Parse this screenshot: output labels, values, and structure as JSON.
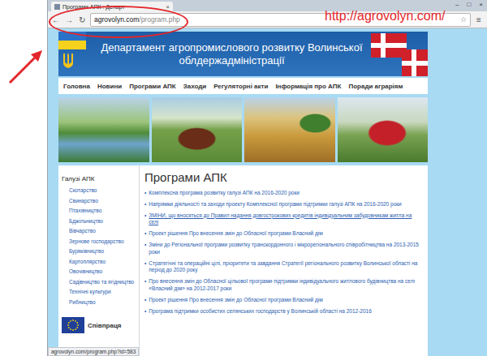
{
  "browser": {
    "tab_title": "Програми АПК : Департ",
    "tab_close": "×",
    "window_controls": [
      "–",
      "□",
      "×"
    ],
    "nav_buttons": [
      "←",
      "→",
      "↻"
    ],
    "url_host": "agrovolyn.com",
    "url_path": "/program.php",
    "star": "☆",
    "menu": "≡",
    "status": "agrovolyn.com/program.php?id=583"
  },
  "annotation": {
    "label": "http://agrovolyn.com/"
  },
  "site": {
    "title_lines": [
      "Департамент агропромислового розвитку Волинської",
      "облдержадміністрації"
    ],
    "nav": [
      "Головна",
      "Новини",
      "Програми АПК",
      "Заходи",
      "Регуляторні акти",
      "Інформація про АПК",
      "Поради аграріям"
    ],
    "photos": [
      {
        "kind": "river"
      },
      {
        "kind": "cattle"
      },
      {
        "kind": "harvest"
      },
      {
        "kind": "tractor"
      }
    ]
  },
  "sidebar": {
    "heading": "Галузі АПК",
    "items": [
      "Скотарство",
      "Свинарство",
      "Птахівництво",
      "Бджільництво",
      "Вівчарство",
      "Зернове господарство",
      "Буряківництво",
      "Картоплярство",
      "Овочівництво",
      "Садівництво та ягідництво",
      "Технічні культури",
      "Рибництво"
    ],
    "partner": "Співпраця"
  },
  "content": {
    "heading": "Програми АПК",
    "bullet": "•",
    "items": [
      {
        "text": "Комплексна програма розвитку галузі АПК на 2016-2020 роки",
        "underlined": false
      },
      {
        "text": "Напрямки діяльності та заходи проекту Комплексної програми підтримки галузі АПК на 2016-2020 роки",
        "underlined": false
      },
      {
        "text": "ЗМІНИ, що вносяться до Правил надання довгострокових кредитів індивідуальним забудовникам житла на селі",
        "underlined": true
      },
      {
        "text": "Проект рішення Про внесення змін до Обласної програми Власний дім",
        "underlined": false
      },
      {
        "text": "Зміни до Регіональної програми розвитку транскордонного і мікрорегіонального співробітництва на 2013-2015 роки",
        "underlined": false
      },
      {
        "text": "Стратегічні та операційні цілі, пріоритети та завдання Стратегії регіонального розвитку Волинської області на період до 2020 року",
        "underlined": false
      },
      {
        "text": "Про внесення змін до Обласної цільової програми підтримки індивідуального житлового будівництва на селі «Власний дім» на 2012-2017 роки",
        "underlined": false
      },
      {
        "text": "Проект рішення Про внесення змін до Обласної програми Власний дім",
        "underlined": false
      },
      {
        "text": "Програма підтримки особистих селянських господарств у Волинській області на 2012-2016",
        "underlined": false
      }
    ]
  }
}
